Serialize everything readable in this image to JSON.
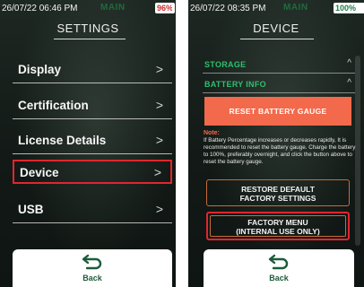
{
  "left_screen": {
    "status": {
      "time": "26/07/22 06:46 PM",
      "mode": "MAIN",
      "battery": "96%"
    },
    "title": "SETTINGS",
    "menu": [
      {
        "label": "Display",
        "arrow": ">"
      },
      {
        "label": "Certification",
        "arrow": ">"
      },
      {
        "label": "License Details",
        "arrow": ">"
      },
      {
        "label": "Device",
        "arrow": ">"
      },
      {
        "label": "USB",
        "arrow": ">"
      }
    ],
    "back_label": "Back"
  },
  "right_screen": {
    "status": {
      "time": "26/07/22 08:35 PM",
      "mode": "MAIN",
      "battery": "100%"
    },
    "title": "DEVICE",
    "sections": [
      {
        "label": "STORAGE",
        "caret": "^"
      },
      {
        "label": "BATTERY INFO",
        "caret": "^"
      }
    ],
    "reset_button": "RESET BATTERY GAUGE",
    "note_title": "Note:",
    "note_text": "If Battery Percentage increases or decreases rapidly, It is recommended to reset the battery gauge. Charge the battery to 100%, preferably overnight, and click the button above to reset the battery gauge.",
    "restore_lines": [
      "RESTORE DEFAULT",
      "FACTORY SETTINGS"
    ],
    "factory_lines": [
      "FACTORY MENU",
      "(INTERNAL USE ONLY)"
    ],
    "back_label": "Back"
  },
  "colors": {
    "accent_green": "#2fbf6e",
    "mode_green": "#1f6b3c",
    "highlight_red": "#e0262e",
    "reset_orange": "#f26a4b"
  }
}
